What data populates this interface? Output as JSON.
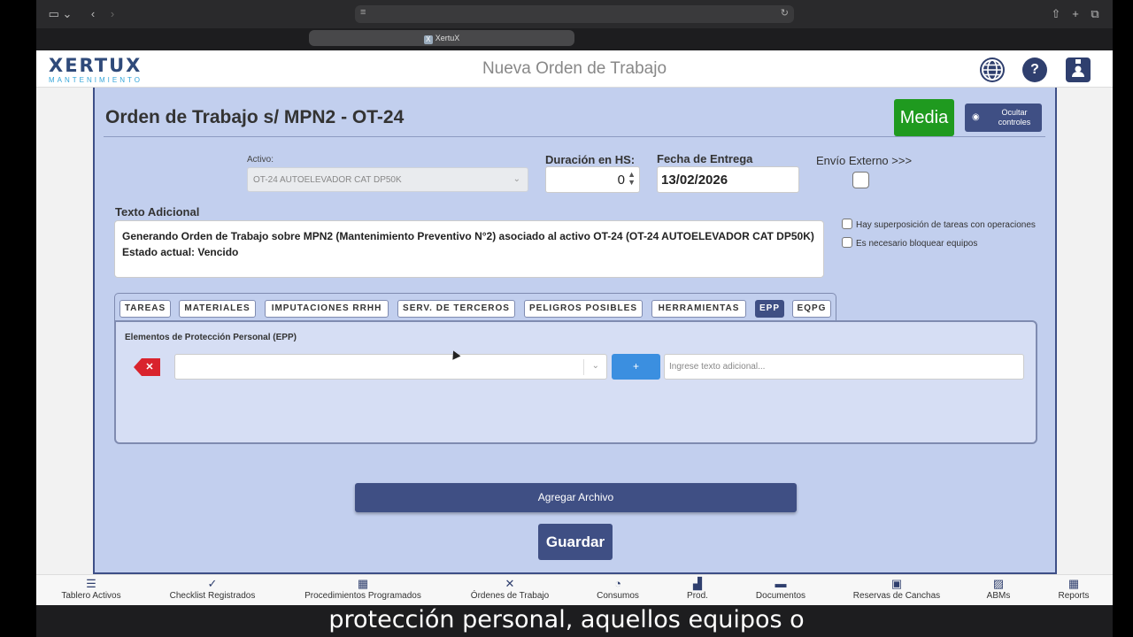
{
  "browser": {
    "tab_title": "XertuX",
    "tab_icon": "X"
  },
  "header": {
    "logo_main": "XERTUX",
    "logo_sub": "MANTENIMIENTO",
    "title": "Nueva Orden de Trabajo",
    "icons": [
      "globe-icon",
      "help-icon",
      "user-badge-icon"
    ],
    "help_glyph": "?"
  },
  "form": {
    "title": "Orden de Trabajo s/ MPN2 - OT-24",
    "media_label": "Media",
    "hide_controls_label": "Ocultar controles",
    "activo_label": "Activo:",
    "activo_value": "OT-24 AUTOELEVADOR CAT DP50K",
    "duracion_label": "Duración en HS:",
    "duracion_value": "0",
    "fecha_label": "Fecha de Entrega",
    "fecha_value": "13/02/2026",
    "envio_label": "Envío Externo >>>",
    "texto_label": "Texto Adicional",
    "texto_line1": "Generando Orden de Trabajo sobre MPN2 (Mantenimiento Preventivo N°2) asociado al activo OT-24 (OT-24 AUTOELEVADOR CAT DP50K)",
    "texto_line2": "Estado actual: Vencido",
    "cb_superposicion": "Hay superposición de tareas con operaciones",
    "cb_bloquear": "Es necesario bloquear equipos",
    "tabs": [
      "TAREAS",
      "MATERIALES",
      "IMPUTACIONES RRHH",
      "SERV. DE TERCEROS",
      "PELIGROS POSIBLES",
      "HERRAMIENTAS",
      "EPP",
      "EQPG"
    ],
    "active_tab": "EPP",
    "epp_label": "Elementos de Protección Personal (EPP)",
    "delete_glyph": "✕",
    "plus_glyph": "+",
    "extra_placeholder": "Ingrese texto adicional...",
    "agregar_label": "Agregar Archivo",
    "guardar_label": "Guardar"
  },
  "bottom_nav": [
    {
      "label": "Tablero Activos",
      "icon": "list-icon",
      "glyph": "☰"
    },
    {
      "label": "Checklist Registrados",
      "icon": "checks-icon",
      "glyph": "✓"
    },
    {
      "label": "Procedimientos Programados",
      "icon": "calendar-icon",
      "glyph": "▦"
    },
    {
      "label": "Órdenes de Trabajo",
      "icon": "tools-icon",
      "glyph": "✕"
    },
    {
      "label": "Consumos",
      "icon": "pie-chart-icon",
      "glyph": "◔"
    },
    {
      "label": "Prod.",
      "icon": "area-chart-icon",
      "glyph": "▟"
    },
    {
      "label": "Documentos",
      "icon": "folder-icon",
      "glyph": "▬"
    },
    {
      "label": "Reservas de Canchas",
      "icon": "calendar-check-icon",
      "glyph": "▣"
    },
    {
      "label": "ABMs",
      "icon": "image-icon",
      "glyph": "▨"
    },
    {
      "label": "Reports",
      "icon": "table-icon",
      "glyph": "▦"
    }
  ],
  "caption": "protección personal, aquellos equipos o",
  "colors": {
    "panel": "#c2cfee",
    "primary": "#3f4f84",
    "media": "#1f9a1f",
    "delete": "#d9232d",
    "plus": "#3b8fe0"
  }
}
